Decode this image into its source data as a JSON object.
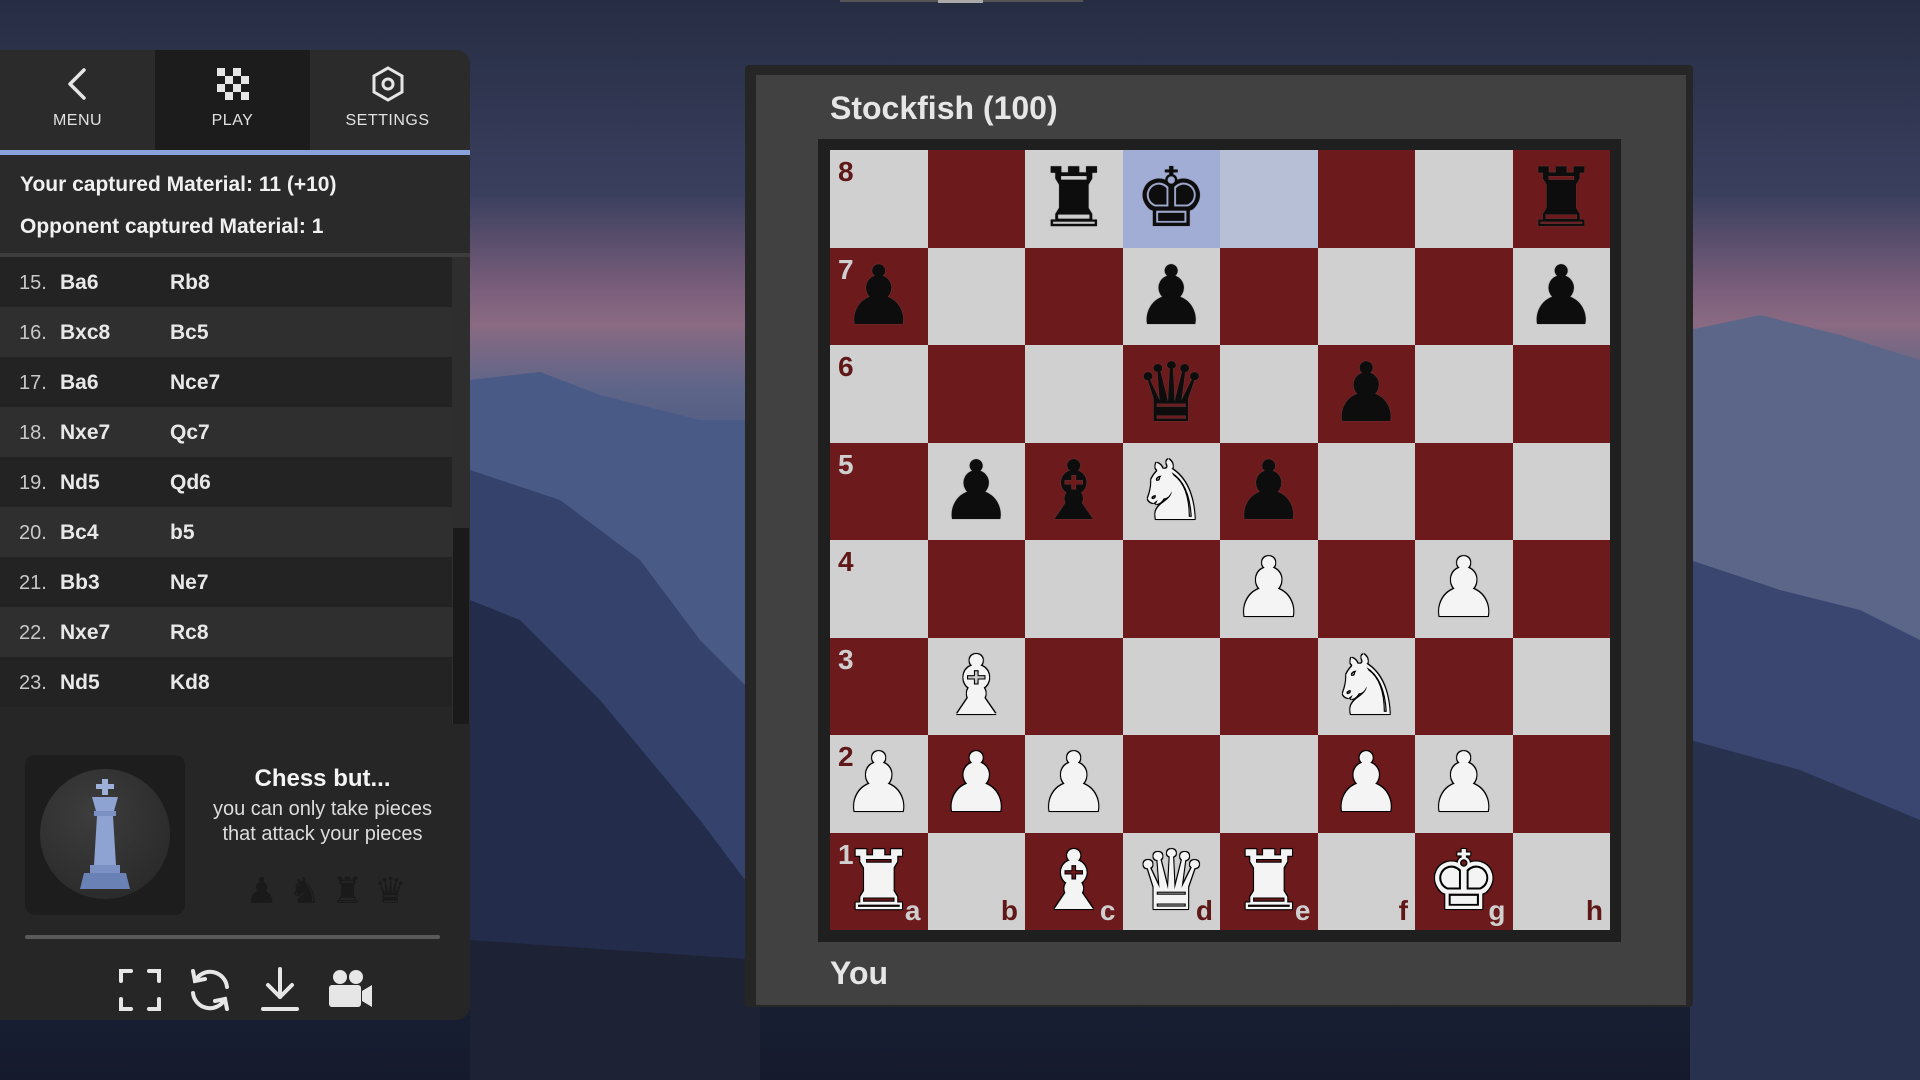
{
  "nav": {
    "menu_label": "MENU",
    "play_label": "PLAY",
    "settings_label": "SETTINGS",
    "active": "PLAY"
  },
  "material": {
    "yours": "Your captured Material: 11 (+10)",
    "opponent": "Opponent captured Material: 1"
  },
  "moves": [
    {
      "num": "15.",
      "white": "Ba6",
      "black": "Rb8"
    },
    {
      "num": "16.",
      "white": "Bxc8",
      "black": "Bc5"
    },
    {
      "num": "17.",
      "white": "Ba6",
      "black": "Nce7"
    },
    {
      "num": "18.",
      "white": "Nxe7",
      "black": "Qc7"
    },
    {
      "num": "19.",
      "white": "Nd5",
      "black": "Qd6"
    },
    {
      "num": "20.",
      "white": "Bc4",
      "black": "b5"
    },
    {
      "num": "21.",
      "white": "Bb3",
      "black": "Ne7"
    },
    {
      "num": "22.",
      "white": "Nxe7",
      "black": "Rc8"
    },
    {
      "num": "23.",
      "white": "Nd5",
      "black": "Kd8"
    }
  ],
  "variant": {
    "title": "Chess but...",
    "description_line1": "you can only take pieces",
    "description_line2": "that attack your pieces",
    "icon": "king-figure-icon",
    "mini_pieces": [
      "♟",
      "♞",
      "♜",
      "♛"
    ]
  },
  "tools": [
    "fullscreen-icon",
    "flip-board-icon",
    "download-icon",
    "camera-icon"
  ],
  "game": {
    "opponent": "Stockfish (100)",
    "player": "You"
  },
  "board": {
    "files": [
      "a",
      "b",
      "c",
      "d",
      "e",
      "f",
      "g",
      "h"
    ],
    "ranks": [
      "8",
      "7",
      "6",
      "5",
      "4",
      "3",
      "2",
      "1"
    ],
    "highlight_last_move": [
      "d8",
      "e8"
    ],
    "colors": {
      "light": "#d0d0d0",
      "dark": "#6d1a1c",
      "highlight": "#8b9cd3"
    },
    "pieces": {
      "c8": "bR",
      "d8": "bK",
      "h8": "bR",
      "a7": "bP",
      "d7": "bP",
      "h7": "bP",
      "d6": "bQ",
      "f6": "bP",
      "b5": "bP",
      "c5": "bB",
      "d5": "wN",
      "e5": "bP",
      "e4": "wP",
      "g4": "wP",
      "b3": "wB",
      "f3": "wN",
      "a2": "wP",
      "b2": "wP",
      "c2": "wP",
      "f2": "wP",
      "g2": "wP",
      "a1": "wR",
      "c1": "wB",
      "d1": "wQ",
      "e1": "wR",
      "g1": "wK"
    }
  }
}
